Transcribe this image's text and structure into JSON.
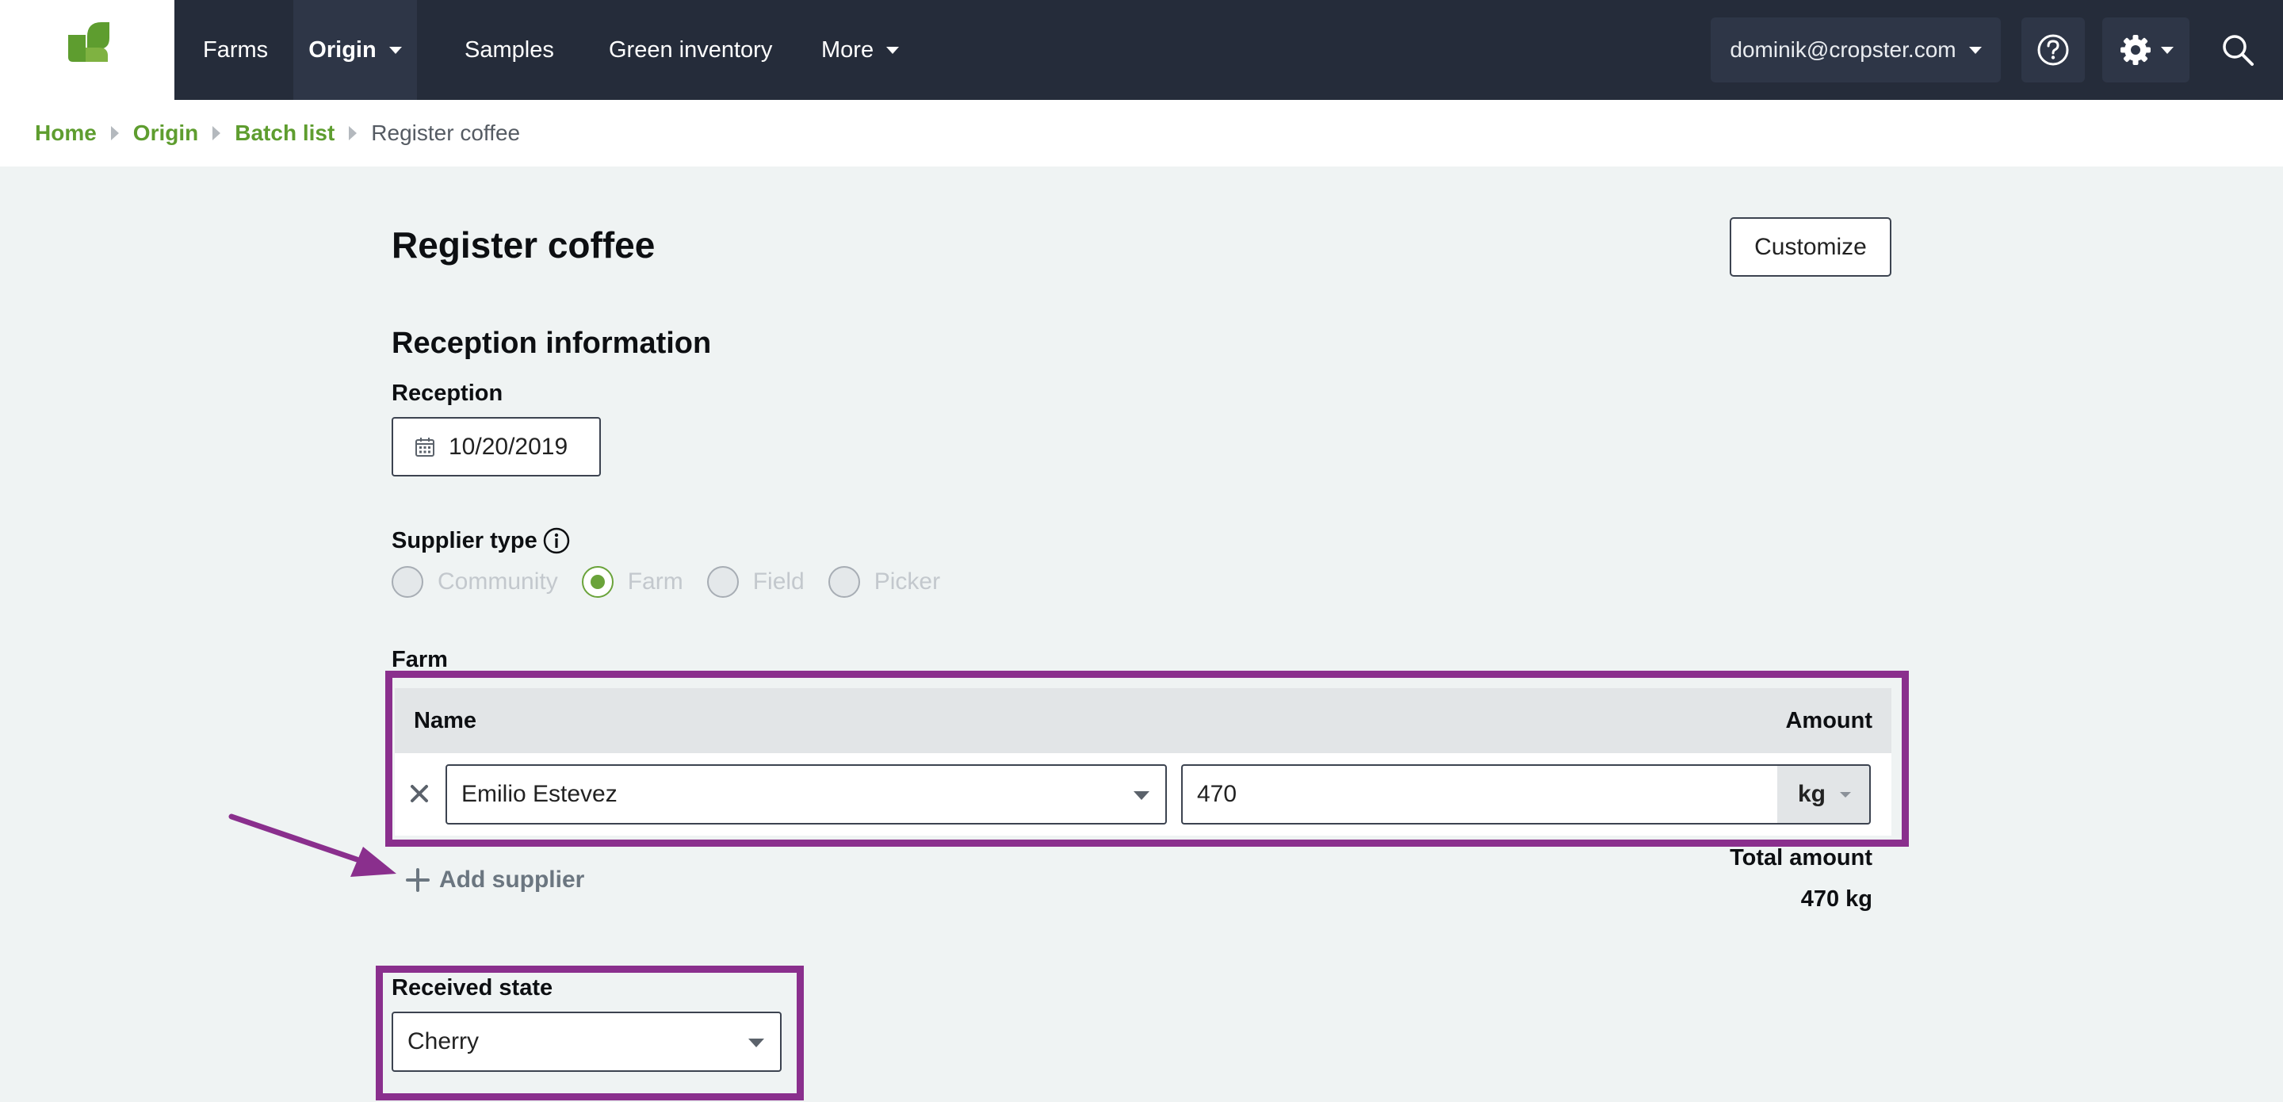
{
  "nav": {
    "items": [
      {
        "label": "Farms"
      },
      {
        "label": "Origin"
      },
      {
        "label": "Samples"
      },
      {
        "label": "Green inventory"
      },
      {
        "label": "More"
      }
    ],
    "user_email": "dominik@cropster.com"
  },
  "colors": {
    "nav_bg": "#252c3a",
    "brand_green": "#5e9d2f",
    "highlight_purple": "#8a2f8d",
    "page_bg": "#eff3f3"
  },
  "icons": {
    "logo": "cropster-leaf-logo",
    "help": "question-circle-icon",
    "settings": "gear-icon",
    "search": "search-icon",
    "calendar": "calendar-icon",
    "info": "info-icon",
    "remove": "close-icon",
    "add": "plus-icon"
  },
  "breadcrumb": {
    "items": [
      {
        "label": "Home"
      },
      {
        "label": "Origin"
      },
      {
        "label": "Batch list"
      }
    ],
    "current": "Register coffee"
  },
  "page": {
    "title": "Register coffee",
    "customize_label": "Customize"
  },
  "reception": {
    "section_title": "Reception information",
    "label": "Reception",
    "date": "10/20/2019"
  },
  "supplier_type": {
    "label": "Supplier type",
    "options": [
      {
        "label": "Community",
        "checked": false
      },
      {
        "label": "Farm",
        "checked": true
      },
      {
        "label": "Field",
        "checked": false
      },
      {
        "label": "Picker",
        "checked": false
      }
    ]
  },
  "farm": {
    "label": "Farm",
    "columns": {
      "name": "Name",
      "amount": "Amount"
    },
    "rows": [
      {
        "name": "Emilio Estevez",
        "amount": "470",
        "unit": "kg"
      }
    ],
    "add_supplier_label": "Add supplier",
    "total_label": "Total amount",
    "total_value": "470 kg"
  },
  "received_state": {
    "label": "Received state",
    "value": "Cherry"
  }
}
